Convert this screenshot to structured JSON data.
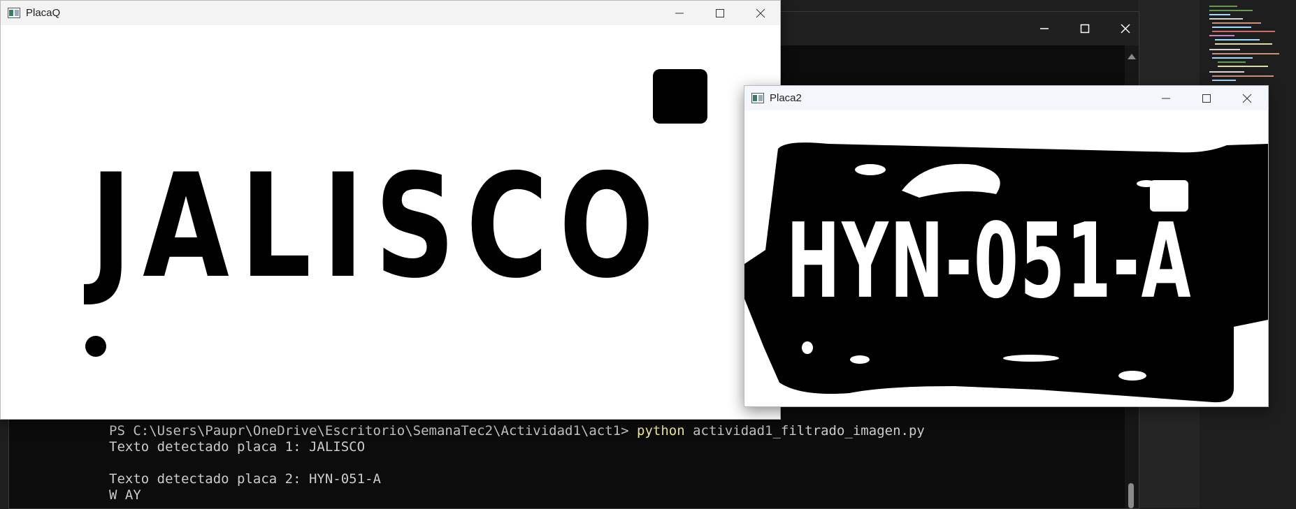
{
  "terminal": {
    "prompt": "PS C:\\Users\\Paupr\\OneDrive\\Escritorio\\SemanaTec2\\Actividad1\\act1>",
    "command": "python",
    "args": "actividad1_filtrado_imagen.py",
    "output_1": "Texto detectado placa 1: JALISCO",
    "output_2": "Texto detectado placa 2: HYN-051-A",
    "output_3": "W AY"
  },
  "window_placa_q": {
    "title": "PlacaQ",
    "image_text": "JALISCO"
  },
  "window_placa_2": {
    "title": "Placa2",
    "image_text": "HYN-051-A"
  },
  "colors": {
    "terminal_bg": "#0c0c0c",
    "terminal_text": "#cccccc",
    "command_highlight": "#f9f1a5",
    "window_title_bg": "#f3f3f3"
  },
  "icons": [
    "minimize-icon",
    "maximize-icon",
    "close-icon",
    "app-icon",
    "scroll-up-arrow-icon"
  ]
}
